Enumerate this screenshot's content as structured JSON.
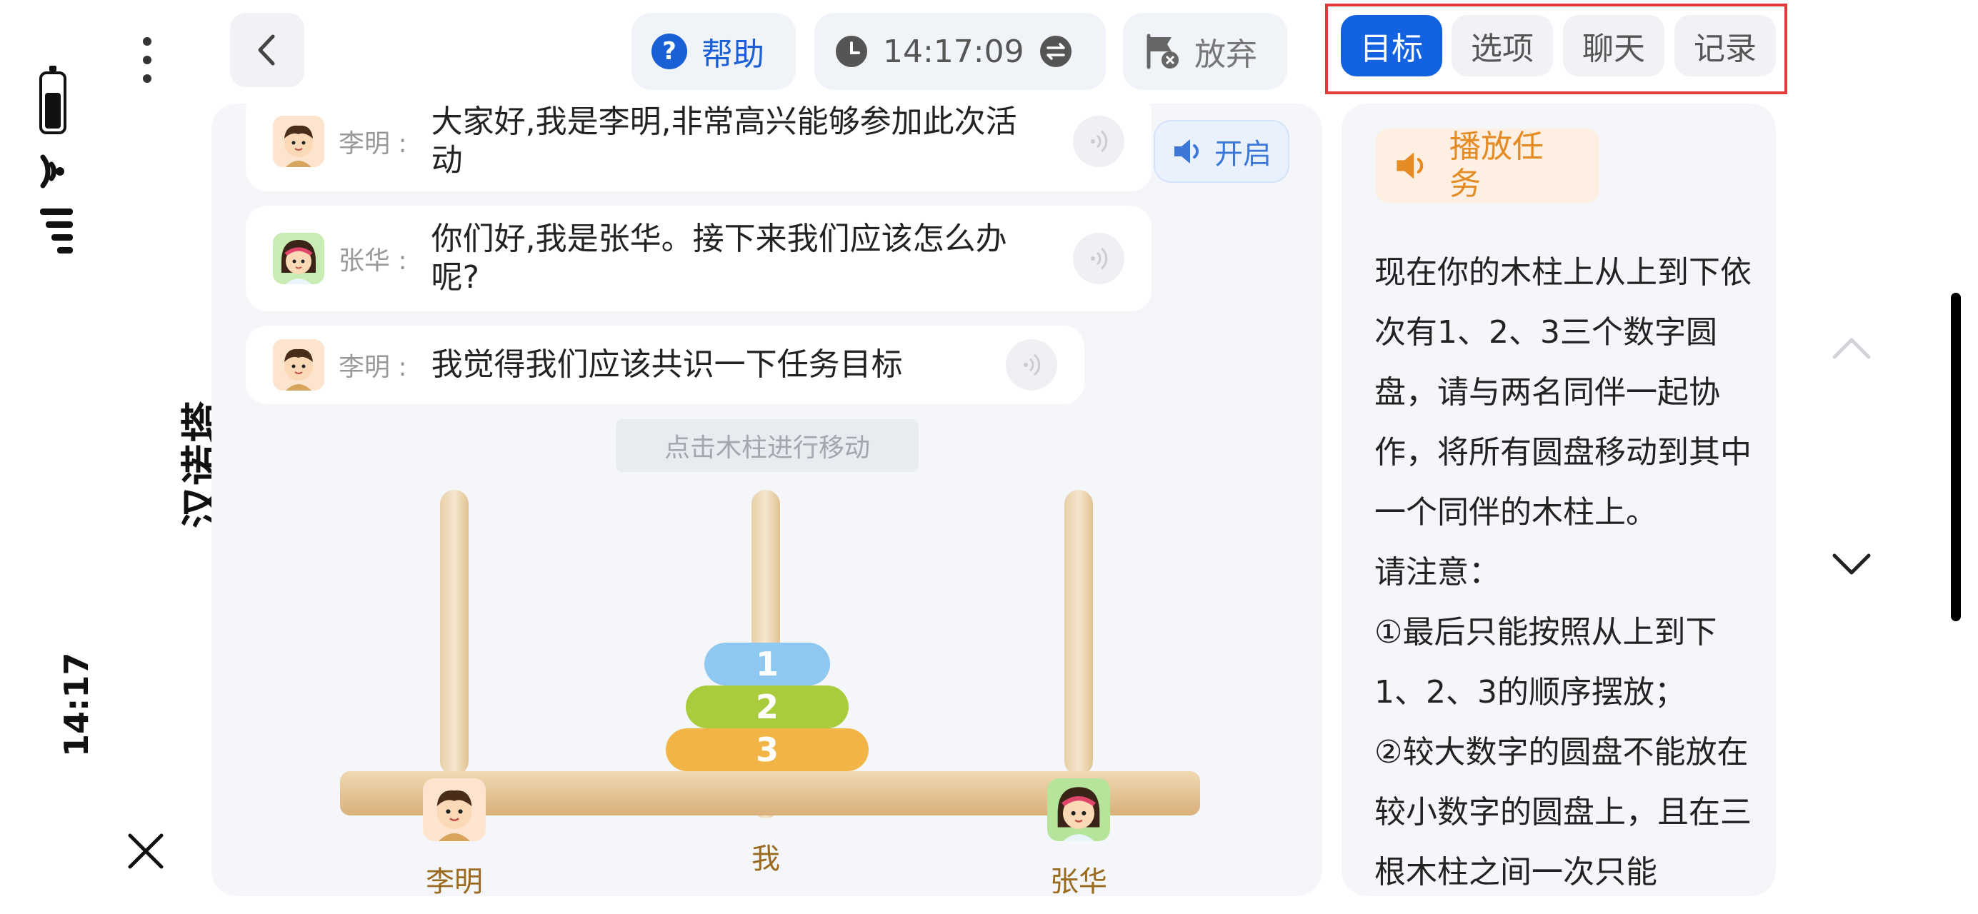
{
  "status_bar": {
    "time": "14:17"
  },
  "app": {
    "title": "汉诺塔"
  },
  "header": {
    "help_label": "帮助",
    "timer": "14:17:09",
    "give_up_label": "放弃"
  },
  "tabs": [
    {
      "label": "目标",
      "active": true
    },
    {
      "label": "选项",
      "active": false
    },
    {
      "label": "聊天",
      "active": false
    },
    {
      "label": "记录",
      "active": false
    }
  ],
  "chat": {
    "messages": [
      {
        "speaker": "李明",
        "separator": ":",
        "text": "大家好,我是李明,非常高兴能够参加此次活动",
        "avatar": "boy"
      },
      {
        "speaker": "张华",
        "separator": ":",
        "text": "你们好,我是张华。接下来我们应该怎么办呢?",
        "avatar": "girl"
      },
      {
        "speaker": "李明",
        "separator": ":",
        "text": "我觉得我们应该共识一下任务目标",
        "avatar": "boy"
      }
    ],
    "voice_toggle_label": "开启"
  },
  "game": {
    "hint": "点击木柱进行移动",
    "pegs": [
      {
        "label": "李明",
        "avatar": "boy"
      },
      {
        "label": "我",
        "avatar": ""
      },
      {
        "label": "张华",
        "avatar": "girl"
      }
    ],
    "disks": [
      {
        "number": "1",
        "color": "#8ec8f0"
      },
      {
        "number": "2",
        "color": "#a8cc3c"
      },
      {
        "number": "3",
        "color": "#f2b447"
      }
    ]
  },
  "task_panel": {
    "play_label": "播放任务",
    "text": "现在你的木柱上从上到下依次有1、2、3三个数字圆盘，请与两名同伴一起协作，将所有圆盘移动到其中一个同伴的木柱上。\n请注意：\n①最后只能按照从上到下1、2、3的顺序摆放；\n②较大数字的圆盘不能放在较小数字的圆盘上，且在三根木柱之间一次只能"
  },
  "colors": {
    "accent": "#1362e0",
    "annotation": "#e23a3a",
    "task_orange": "#e58b24",
    "label_brown": "#9a6a1f"
  }
}
